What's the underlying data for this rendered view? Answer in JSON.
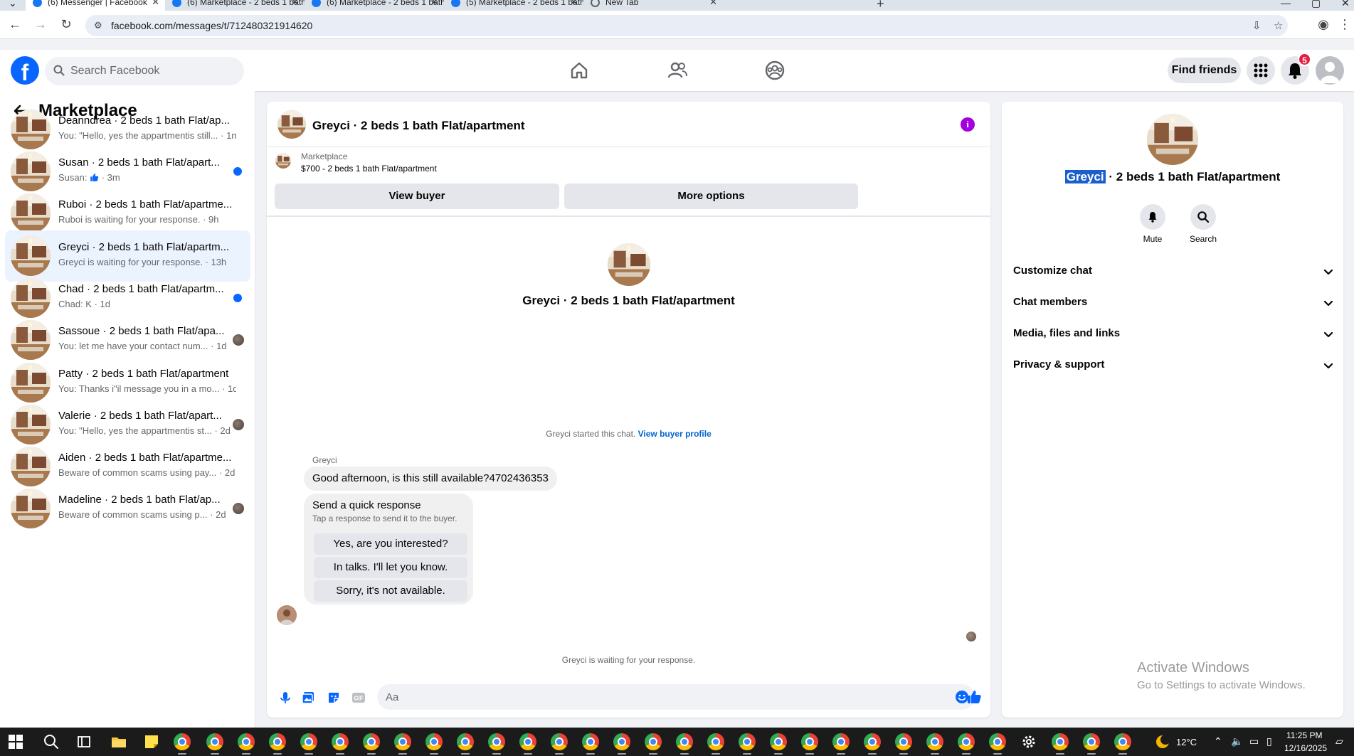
{
  "browser": {
    "tabs": [
      {
        "title": "(6) Messenger | Facebook",
        "active": true
      },
      {
        "title": "(6) Marketplace - 2 beds 1 bath",
        "active": false
      },
      {
        "title": "(6) Marketplace - 2 beds 1 bath",
        "active": false
      },
      {
        "title": "(5) Marketplace - 2 beds 1 bath",
        "active": false
      },
      {
        "title": "New Tab",
        "active": false
      }
    ],
    "url": "facebook.com/messages/t/712480321914620"
  },
  "fb": {
    "search_placeholder": "Search Facebook",
    "find_friends": "Find friends",
    "notif_count": "5"
  },
  "sidebar": {
    "title": "Marketplace",
    "conversations": [
      {
        "name": "Deanndrea · 2 beds 1 bath Flat/ap...",
        "sub": "You: \"Hello, yes the appartmentis still... · 1m",
        "indicator": "none",
        "selected": false
      },
      {
        "name": "Susan · 2 beds 1 bath Flat/apart...",
        "sub_prefix": "Susan:",
        "sub_suffix": "· 3m",
        "indicator": "unread",
        "selected": false,
        "like": true
      },
      {
        "name": "Ruboi · 2 beds 1 bath Flat/apartme...",
        "sub": "Ruboi is waiting for your response. · 9h",
        "indicator": "none",
        "selected": false
      },
      {
        "name": "Greyci · 2 beds 1 bath Flat/apartm...",
        "sub": "Greyci is waiting for your response. · 13h",
        "indicator": "none",
        "selected": true
      },
      {
        "name": "Chad · 2 beds 1 bath Flat/apartm...",
        "sub": "Chad: K · 1d",
        "indicator": "unread",
        "selected": false
      },
      {
        "name": "Sassoue · 2 beds 1 bath Flat/apa...",
        "sub": "You: let me have your contact num... · 1d",
        "indicator": "seen",
        "selected": false
      },
      {
        "name": "Patty · 2 beds 1 bath Flat/apartment",
        "sub": "You: Thanks i\"il message you in a mo... · 1d",
        "indicator": "none",
        "selected": false
      },
      {
        "name": "Valerie · 2 beds 1 bath Flat/apart...",
        "sub": "You: \"Hello, yes the appartmentis st... · 2d",
        "indicator": "seen",
        "selected": false
      },
      {
        "name": "Aiden · 2 beds 1 bath Flat/apartme...",
        "sub": "Beware of common scams using pay... · 2d",
        "indicator": "none",
        "selected": false
      },
      {
        "name": "Madeline · 2 beds 1 bath Flat/ap...",
        "sub": "Beware of common scams using p... · 2d",
        "indicator": "seen",
        "selected": false
      }
    ]
  },
  "chat": {
    "title": "Greyci · 2 beds 1 bath Flat/apartment",
    "marketplace_label": "Marketplace",
    "listing": "$700 - 2 beds 1 bath Flat/apartment",
    "view_buyer": "View buyer",
    "more_options": "More options",
    "center_title": "Greyci · 2 beds 1 bath Flat/apartment",
    "started_text": "Greyci started this chat.",
    "view_buyer_profile": "View buyer profile",
    "sender": "Greyci",
    "message": "Good afternoon, is this still available?4702436353",
    "quick_response": {
      "title": "Send a quick response",
      "subtitle": "Tap a response to send it to the buyer.",
      "options": [
        "Yes, are you interested?",
        "In talks. I'll let you know.",
        "Sorry, it's not available."
      ]
    },
    "waiting": "Greyci is waiting for your response.",
    "composer_placeholder": "Aa"
  },
  "info_panel": {
    "title_highlight": "Greyci",
    "title_rest": " · 2 beds 1 bath Flat/apartment",
    "mute": "Mute",
    "search": "Search",
    "sections": [
      "Customize chat",
      "Chat members",
      "Media, files and links",
      "Privacy & support"
    ]
  },
  "watermark": {
    "line1": "Activate Windows",
    "line2": "Go to Settings to activate Windows."
  },
  "taskbar": {
    "temperature": "12°C",
    "time": "11:25 PM",
    "date": "12/16/2025"
  },
  "colors": {
    "fb_blue": "#0866ff",
    "selected_bg": "#ebf3ff",
    "info_purple": "#a300e0",
    "badge_red": "#e41e3f"
  }
}
